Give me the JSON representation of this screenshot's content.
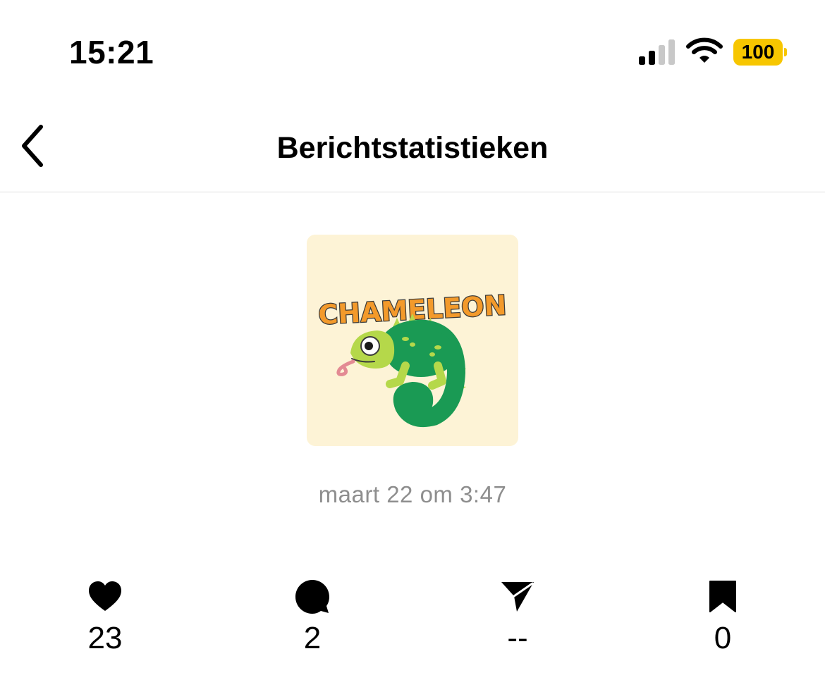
{
  "status_bar": {
    "time": "15:21",
    "battery": "100",
    "battery_color": "#f7c600"
  },
  "nav": {
    "title": "Berichtstatistieken",
    "back_icon": "chevron-left-icon"
  },
  "post": {
    "thumbnail_text": "CHAMELEON",
    "date": "maart 22 om 3:47"
  },
  "stats": [
    {
      "icon": "heart-icon",
      "value": "23"
    },
    {
      "icon": "comment-icon",
      "value": "2"
    },
    {
      "icon": "share-icon",
      "value": "--"
    },
    {
      "icon": "bookmark-icon",
      "value": "0"
    }
  ]
}
